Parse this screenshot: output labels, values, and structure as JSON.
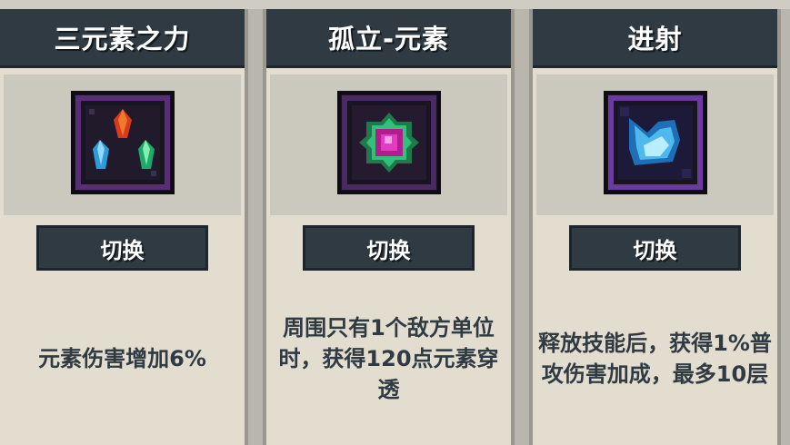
{
  "cards": [
    {
      "title": "三元素之力",
      "icon": "three-element-crystals-icon",
      "switch_label": "切换",
      "description": "元素伤害增加6%"
    },
    {
      "title": "孤立-元素",
      "icon": "isolated-element-orb-icon",
      "switch_label": "切换",
      "description": "周围只有1个敌方单位时，获得120点元素穿透"
    },
    {
      "title": "进射",
      "icon": "ricochet-shard-icon",
      "switch_label": "切换",
      "description": "释放技能后，获得1%普攻伤害加成，最多10层"
    }
  ],
  "colors": {
    "header_bg": "#2f3a42",
    "card_bg": "#e2ddcf",
    "icon_area_bg": "#cbc8be",
    "text_dark": "#2f3a42",
    "frame_purple": "#5a2d78"
  }
}
